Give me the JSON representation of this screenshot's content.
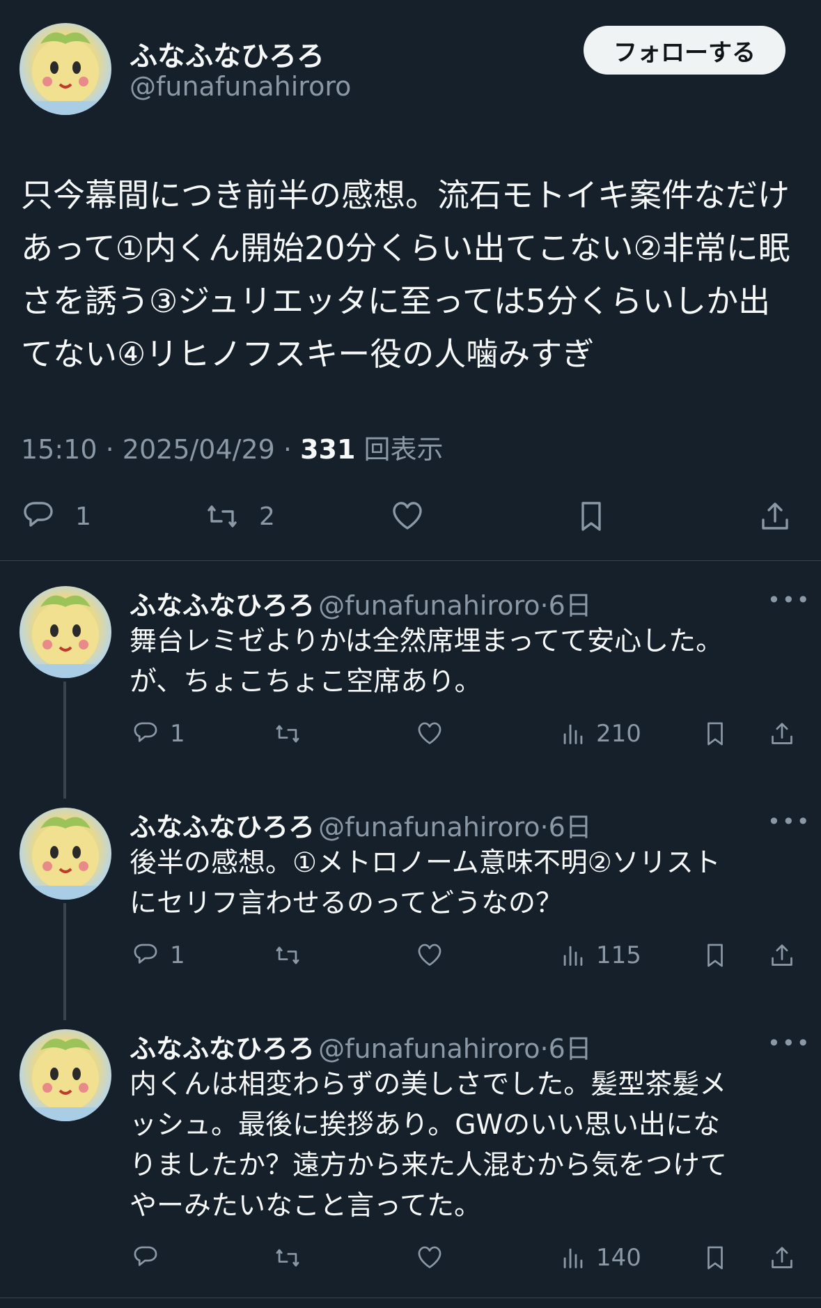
{
  "main_tweet": {
    "display_name": "ふなふなひろろ",
    "handle": "@funafunahiroro",
    "follow_label": "フォローする",
    "text": "只今幕間につき前半の感想。流石モトイキ案件なだけあって①内くん開始20分くらい出てこない②非常に眠さを誘う③ジュリエッタに至っては5分くらいしか出てない④リヒノフスキー役の人噛みすぎ",
    "time": "15:10",
    "date": "2025/04/29",
    "separator": "·",
    "views_count": "331",
    "views_label": "回表示",
    "reply_count": "1",
    "retweet_count": "2"
  },
  "replies": [
    {
      "display_name": "ふなふなひろろ",
      "handle": "@funafunahiroro",
      "age": "6日",
      "text": "舞台レミゼよりかは全然席埋まってて安心した。\nが、ちょこちょこ空席あり。",
      "reply_count": "1",
      "views": "210"
    },
    {
      "display_name": "ふなふなひろろ",
      "handle": "@funafunahiroro",
      "age": "6日",
      "text": "後半の感想。①メトロノーム意味不明②ソリスト\nにセリフ言わせるのってどうなの？",
      "reply_count": "1",
      "views": "115"
    },
    {
      "display_name": "ふなふなひろろ",
      "handle": "@funafunahiroro",
      "age": "6日",
      "text": "内くんは相変わらずの美しさでした。髪型茶髪メ\nッシュ。最後に挨拶あり。GWのいい思い出にな\nりましたか？遠方から来た人混むから気をつけて\nやーみたいなこと言ってた。",
      "reply_count": "",
      "views": "140"
    }
  ],
  "colors": {
    "background": "#15202b",
    "text": "#f7f9f9",
    "muted": "#8b98a5",
    "divider": "#38444d"
  }
}
